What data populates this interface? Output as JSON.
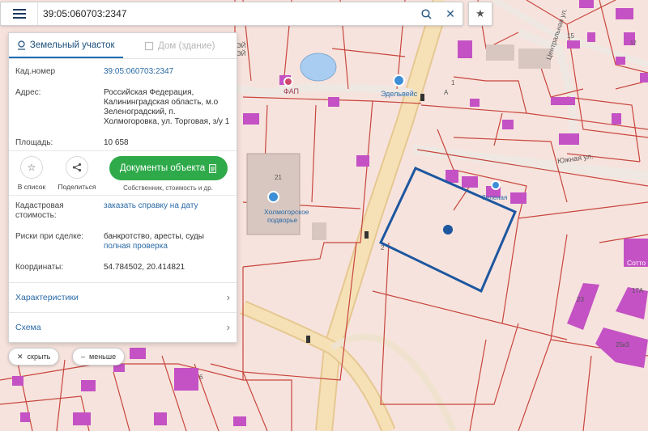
{
  "search": {
    "value": "39:05:060703:2347"
  },
  "tabs": [
    {
      "label": "Земельный участок",
      "icon": "pin-icon"
    },
    {
      "label": "Дом (здание)",
      "icon": "building-icon"
    }
  ],
  "info": {
    "cad_number_label": "Кад.номер",
    "cad_number_value": "39:05:060703:2347",
    "address_label": "Адрес:",
    "address_lines": [
      "Российская Федерация,",
      "Калининградская область, м.о",
      "Зеленоградский, п.",
      "Холмогоровка, ул. Торговая, з/у 1"
    ],
    "area_label": "Площадь:",
    "area_value": "10 658"
  },
  "actions": {
    "favorite_label": "В список",
    "share_label": "Поделиться",
    "docs_button": "Документы объекта",
    "docs_sub": "Собственник, стоимость и др."
  },
  "details": {
    "cadastral_label_1": "Кадастровая",
    "cadastral_label_2": "стоимость:",
    "cadastral_link": "заказать справку на дату",
    "risks_label": "Риски при сделке:",
    "risks_value": "банкротство, аресты, суды",
    "risks_link": "полная проверка",
    "coords_label": "Координаты:",
    "coords_value": "54.784502, 20.414821"
  },
  "sections": {
    "characteristics": "Характеристики",
    "scheme": "Схема"
  },
  "buttons": {
    "hide": "скрыть",
    "less": "меньше"
  },
  "map": {
    "colors": {
      "parcel_fill": "#f7e3dd",
      "parcel_line": "#c7463e",
      "building": "#c452c4",
      "road": "#f2d8a6",
      "selected_outline": "#1d57a0",
      "water": "#a9cdf0"
    },
    "labels": {
      "fap": "ФАП",
      "edelveis": "Эдельвейс",
      "zelenaya": "Зеленая",
      "kholmogorskoe_1": "Холмогорское",
      "kholmogorskoe_2": "подворье",
      "yuzhnaya": "Южная ул.",
      "tsentralnaya": "Центральная ул.",
      "num_21": "21",
      "num_1": "1",
      "num_A": "А",
      "num_2": "2",
      "num_6": "6",
      "num_12": "12",
      "num_17A": "17А",
      "num_25k3": "25к3",
      "num_23": "23",
      "num_15": "15",
      "sotto": "Сотто",
      "zh_1": "ЭЙ",
      "zh_2": "ЭЙ"
    }
  }
}
